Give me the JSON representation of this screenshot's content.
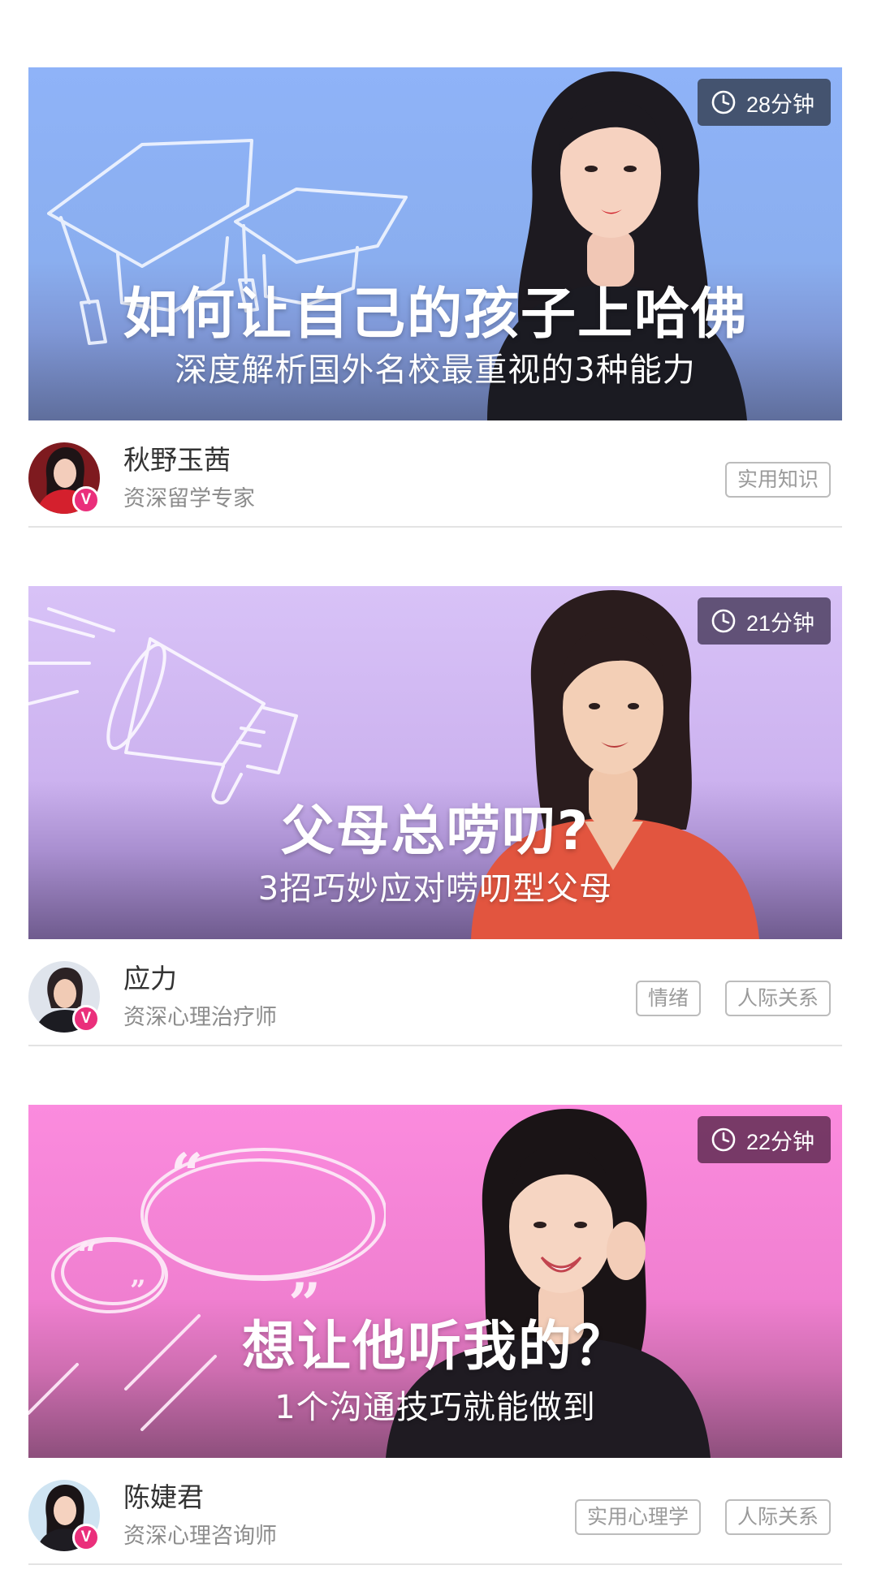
{
  "courses": [
    {
      "title": "如何让自己的孩子上哈佛",
      "subtitle": "深度解析国外名校最重视的3种能力",
      "duration": "28分钟",
      "author": {
        "name": "秋野玉茜",
        "title": "资深留学专家",
        "verified_mark": "V"
      },
      "tags": [
        "实用知识"
      ],
      "banner_color": "#8fb3f8",
      "decoration_icon": "graduation-cap-icon"
    },
    {
      "title": "父母总唠叨?",
      "subtitle": "3招巧妙应对唠叨型父母",
      "duration": "21分钟",
      "author": {
        "name": "应力",
        "title": "资深心理治疗师",
        "verified_mark": "V"
      },
      "tags": [
        "情绪",
        "人际关系"
      ],
      "banner_color": "#d8c2f7",
      "decoration_icon": "megaphone-icon"
    },
    {
      "title": "想让他听我的？",
      "subtitle": "1个沟通技巧就能做到",
      "duration": "22分钟",
      "author": {
        "name": "陈婕君",
        "title": "资深心理咨询师",
        "verified_mark": "V"
      },
      "tags": [
        "实用心理学",
        "人际关系"
      ],
      "banner_color": "#fb8bde",
      "decoration_icon": "speech-bubble-icon"
    }
  ],
  "colors": {
    "verified_badge": "#ea2f7b",
    "tag_border": "#bcbcbc",
    "divider": "#e3e3e3"
  }
}
